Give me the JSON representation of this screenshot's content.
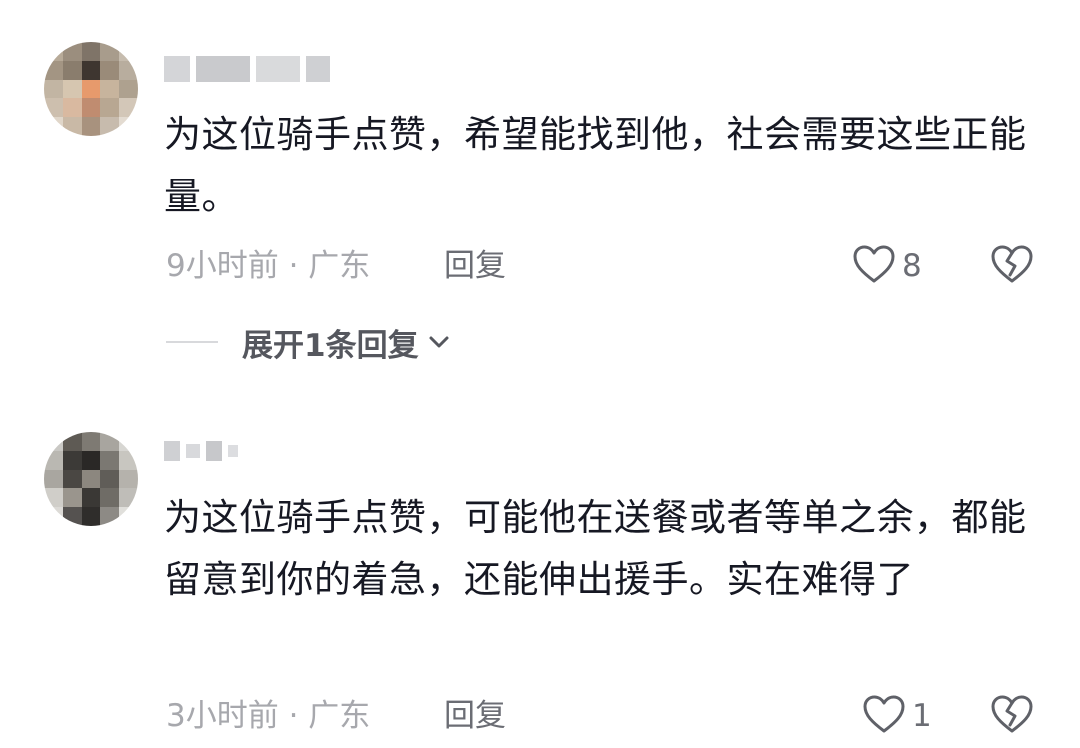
{
  "comments": [
    {
      "text": "为这位骑手点赞，希望能找到他，社会需要这些正能量。",
      "time_location": "9小时前 · 广东",
      "reply_label": "回复",
      "like_count": "8",
      "expand_label": "展开1条回复"
    },
    {
      "text": "为这位骑手点赞，可能他在送餐或者等单之余，都能留意到你的着急，还能伸出援手。实在难得了",
      "time_location": "3小时前 · 广东",
      "reply_label": "回复",
      "like_count": "1"
    }
  ],
  "icons": {
    "like": "heart-outline-icon",
    "dislike": "broken-heart-icon",
    "expand": "chevron-down-icon"
  },
  "colors": {
    "text": "#161823",
    "meta": "#a7a8ad",
    "action": "#6b6d74"
  }
}
